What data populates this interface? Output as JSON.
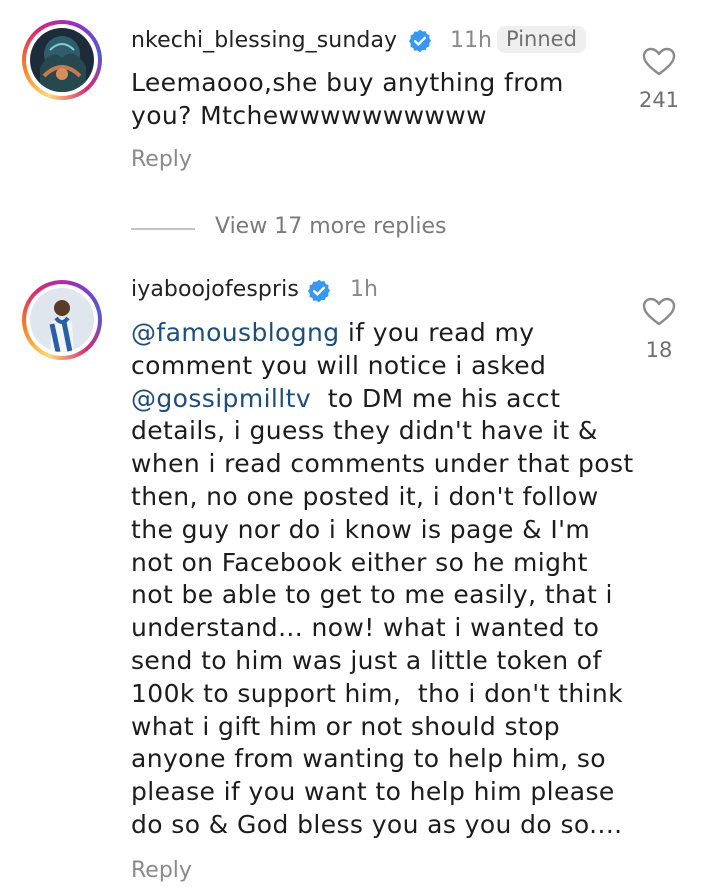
{
  "comments": [
    {
      "username": "nkechi_blessing_sunday",
      "time": "11h",
      "badge": "Pinned",
      "text_lines": [
        "Leemaooo,she buy anything from",
        "you? Mtchewwwwwwwwww"
      ],
      "reply_label": "Reply",
      "likes": "241"
    },
    {
      "username": "iyaboojofespris",
      "time": "1h",
      "text_line_1_mention": "@famousblogng",
      "text_line_1_rest": " if you read my",
      "text_line_2": "comment you will notice i asked",
      "text_line_3_mention": "@gossipmilltv",
      "text_line_3_rest": "  to DM me his acct",
      "text_lines_rest": [
        "details, i guess they didn't have it &",
        "when i read comments under that post",
        "then, no one posted it, i don't follow",
        "the guy nor do i know is page & I'm",
        "not on Facebook either so he might",
        "not be able to get to me easily, that i",
        "understand... now! what i wanted to",
        "send to him was just a little token of",
        "100k to support him,  tho i don't think",
        "what i gift him or not should stop",
        "anyone from wanting to help him, so",
        "please if you want to help him please",
        "do so & God bless you as you do so...."
      ],
      "reply_label": "Reply",
      "likes": "18"
    }
  ],
  "view_more_replies": "View 17 more replies",
  "colors": {
    "verified": "#3897f0",
    "mention": "#1f4d7a",
    "muted": "#8a8a8a"
  }
}
